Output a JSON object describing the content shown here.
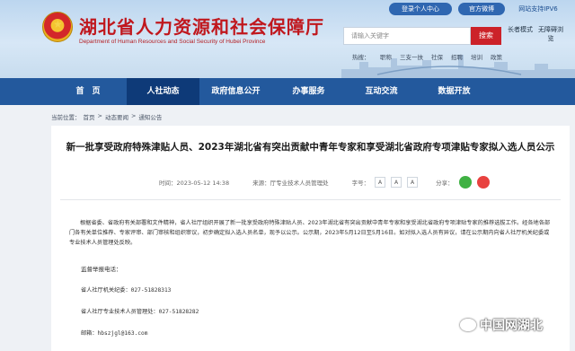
{
  "header": {
    "title": "湖北省人力资源和社会保障厅",
    "subtitle": "Department of Human Resources and Social Security of Hubei Province",
    "login_label": "登录个人中心",
    "weibo_label": "官方微博",
    "ipv6_label": "网站支持IPV6",
    "search_placeholder": "请输入关键字",
    "search_button": "搜索",
    "elder_mode": "长者模式",
    "barrier_free": "无障碍浏览",
    "hot_label": "热搜：",
    "hot_words": [
      "职称",
      "三支一扶",
      "社保",
      "招聘",
      "培训",
      "政策"
    ]
  },
  "nav": {
    "items": [
      "首　页",
      "人社动态",
      "政府信息公开",
      "办事服务",
      "互动交流",
      "数据开放"
    ]
  },
  "breadcrumb": [
    "当前位置：",
    "首页",
    ">",
    "动态要闻",
    ">",
    "通知公告"
  ],
  "article": {
    "title": "新一批享受政府特殊津贴人员、2023年湖北省有突出贡献中青年专家和享受湖北省政府专项津贴专家拟入选人员公示",
    "date": "时间：2023-05-12 14:38",
    "source": "来源：厅专业技术人员管理处",
    "font_label": "字号：",
    "font_sizes": [
      "A",
      "A",
      "A"
    ],
    "share_label": "分享：",
    "body": "根据省委、省政府有关部署和文件精神，省人社厅组织开展了新一批享受政府特殊津贴人员、2023年湖北省有突出贡献中青年专家和享受湖北省政府专项津贴专家的推荐选拔工作。经各地各部门各有关单位推荐、专家评审、部门审核和组织审议，初步确定拟入选人员名单，现予以公示。公示期，2023年5月12日至5月16日。如对拟入选人员有异议，请在公示期内向省人社厅机关纪委或专业技术人员管理处反映。",
    "supervise_label": "监督举报电话：",
    "contact1": "省人社厅机关纪委：027-51828313",
    "contact2": "省人社厅专业技术人员管理处：027-51828282",
    "contact3": "邮箱：hbszjgl@163.com"
  },
  "watermark": "中国网湖北",
  "colors": {
    "nav": "#23599d",
    "nav_active": "#0e3a78",
    "accent_red": "#cc2229",
    "title_red": "#c0171d"
  }
}
